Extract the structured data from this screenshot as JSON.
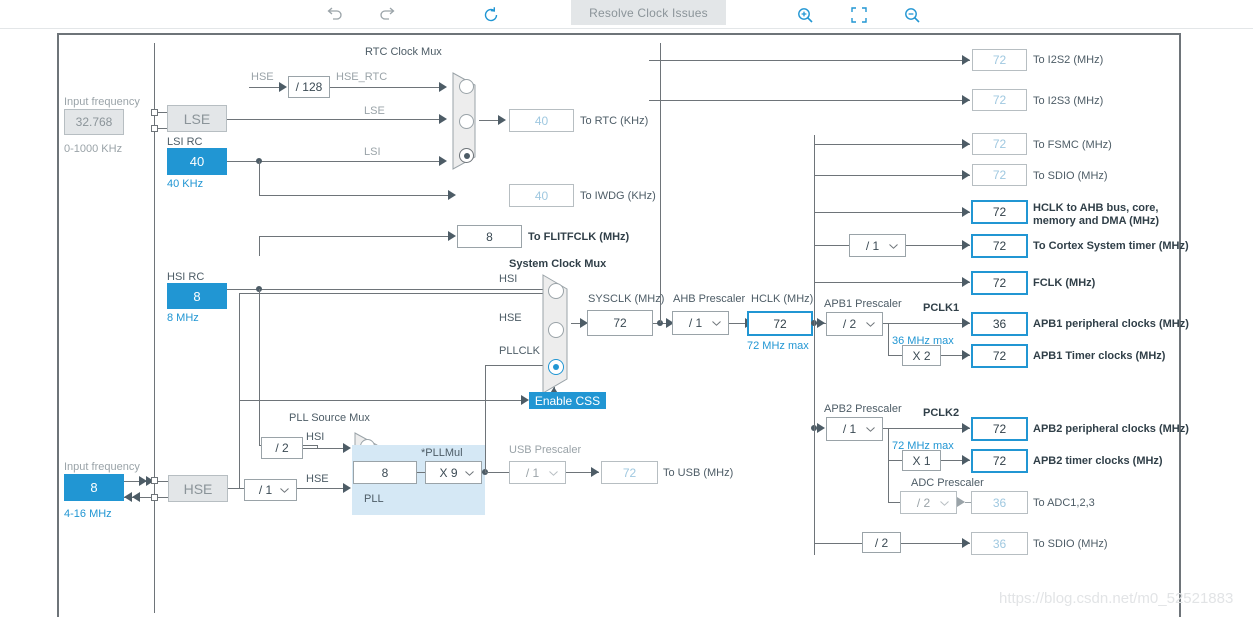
{
  "toolbar": {
    "undo": "undo-icon",
    "redo": "redo-icon",
    "reset": "reset-icon",
    "resolve_label": "Resolve Clock Issues",
    "zoom_in": "zoom-in-icon",
    "fit": "fit-icon",
    "zoom_out": "zoom-out-icon"
  },
  "lse": {
    "input_frequency_label": "Input frequency",
    "value": "32.768",
    "range": "0-1000 KHz",
    "name": "LSE"
  },
  "lsi": {
    "title": "LSI RC",
    "value": "40",
    "unit": "40 KHz"
  },
  "hsi": {
    "title": "HSI RC",
    "value": "8",
    "unit": "8 MHz"
  },
  "hse": {
    "input_frequency_label": "Input frequency",
    "value": "8",
    "range": "4-16 MHz",
    "name": "HSE",
    "divider": "/ 1",
    "rtc_divider": "/ 128",
    "rtc_in_label": "HSE",
    "rtc_out_label": "HSE_RTC"
  },
  "rtc_mux": {
    "title": "RTC Clock Mux",
    "inputs": [
      "HSE_RTC",
      "LSE",
      "LSI"
    ],
    "selected": 2
  },
  "rtc_out": {
    "value": "40",
    "label": "To RTC (KHz)"
  },
  "iwdg_out": {
    "value": "40",
    "label": "To IWDG (KHz)"
  },
  "flitf_out": {
    "value": "8",
    "label": "To FLITFCLK (MHz)"
  },
  "sys_mux": {
    "title": "System Clock Mux",
    "inputs": [
      "HSI",
      "HSE",
      "PLLCLK"
    ],
    "selected": 2,
    "css_label": "Enable CSS"
  },
  "pll_mux": {
    "title": "PLL Source Mux",
    "inputs": [
      "HSI",
      "HSE"
    ],
    "selected": 1,
    "hsi_divider": "/ 2"
  },
  "pll": {
    "group_label": "PLL",
    "input_value": "8",
    "mul_label": "*PLLMul",
    "mul_value": "X 9"
  },
  "usb": {
    "title": "USB Prescaler",
    "value": "/ 1",
    "out": "72",
    "label": "To USB (MHz)"
  },
  "sysclk": {
    "title": "SYSCLK (MHz)",
    "value": "72"
  },
  "ahb": {
    "title": "AHB Prescaler",
    "value": "/ 1"
  },
  "hclk": {
    "title": "HCLK (MHz)",
    "value": "72",
    "max": "72 MHz max"
  },
  "outputs": {
    "i2s2": {
      "value": "72",
      "label": "To I2S2 (MHz)"
    },
    "i2s3": {
      "value": "72",
      "label": "To I2S3 (MHz)"
    },
    "fsmc": {
      "value": "72",
      "label": "To FSMC (MHz)"
    },
    "sdio_ahb": {
      "value": "72",
      "label": "To SDIO (MHz)"
    },
    "hclk_ahb": {
      "value": "72",
      "label_line1": "HCLK to AHB bus, core,",
      "label_line2": "memory and DMA (MHz)"
    },
    "cortex": {
      "prescaler": "/ 1",
      "value": "72",
      "label": "To Cortex System timer (MHz)"
    },
    "fclk": {
      "value": "72",
      "label": "FCLK (MHz)"
    },
    "adc": {
      "prescaler_title": "ADC Prescaler",
      "prescaler": "/ 2",
      "value": "36",
      "label": "To ADC1,2,3"
    },
    "sdio_apb2": {
      "divider": "/ 2",
      "value": "36",
      "label": "To SDIO (MHz)"
    }
  },
  "apb1": {
    "title": "APB1 Prescaler",
    "prescaler": "/ 2",
    "pclk_label": "PCLK1",
    "max": "36 MHz max",
    "periph": {
      "value": "36",
      "label": "APB1 peripheral clocks (MHz)"
    },
    "timer_mul": "X 2",
    "timer": {
      "value": "72",
      "label": "APB1 Timer clocks (MHz)"
    }
  },
  "apb2": {
    "title": "APB2 Prescaler",
    "prescaler": "/ 1",
    "pclk_label": "PCLK2",
    "max": "72 MHz max",
    "periph": {
      "value": "72",
      "label": "APB2 peripheral clocks (MHz)"
    },
    "timer_mul": "X 1",
    "timer": {
      "value": "72",
      "label": "APB2 timer clocks (MHz)"
    }
  },
  "watermark": "https://blog.csdn.net/m0_52521883",
  "colors": {
    "accent": "#2196d3",
    "wire": "#6e7479",
    "pll_bg": "#d5e8f5"
  }
}
